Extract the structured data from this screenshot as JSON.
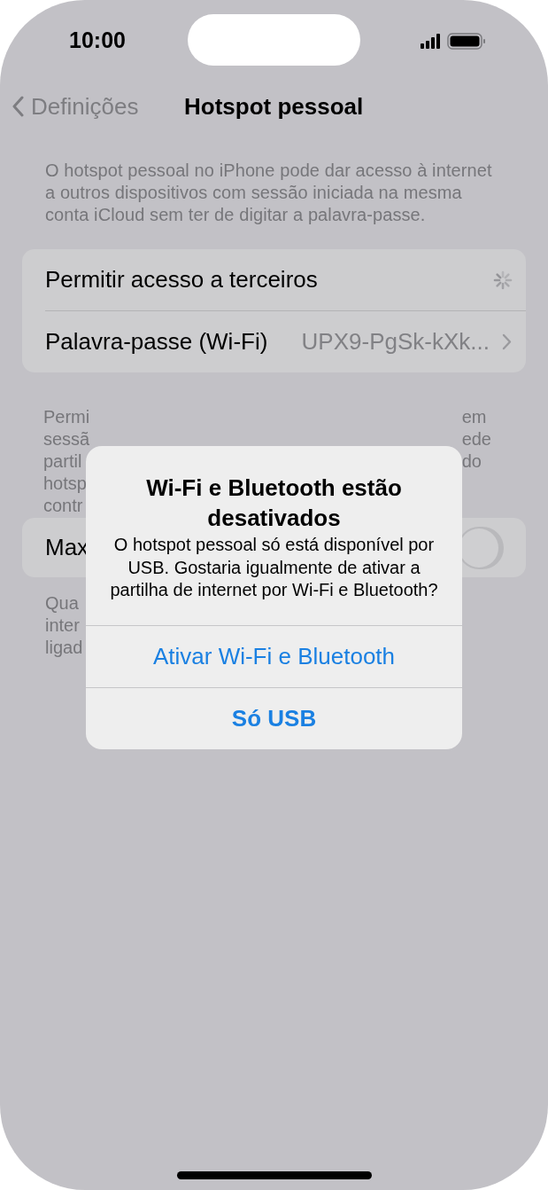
{
  "status_bar": {
    "time": "10:00"
  },
  "nav": {
    "back": "Definições",
    "title": "Hotspot pessoal"
  },
  "intro": "O hotspot pessoal no iPhone pode dar acesso à internet a outros dispositivos com sessão iniciada na mesma conta iCloud sem ter de digitar a palavra-passe.",
  "settings": [
    {
      "kind": "loading",
      "label": "Permitir acesso a terceiros"
    },
    {
      "kind": "link",
      "label": "Palavra-passe (Wi-Fi)",
      "value": "UPX9-PgSk-kXk..."
    }
  ],
  "note_1": {
    "left": [
      "Permi",
      "sessã",
      "partil",
      "hotsp",
      "contr"
    ],
    "right": [
      "em",
      "ede",
      "do"
    ]
  },
  "maximize_row": {
    "label": "Max",
    "on": false
  },
  "note_2": {
    "left": [
      "Qua",
      "inter",
      "ligad"
    ]
  },
  "alert": {
    "title": "Wi-Fi e Bluetooth estão desativados",
    "message": "O hotspot pessoal só está disponível por USB. Gostaria igualmente de ativar a partilha de internet por Wi-Fi e Bluetooth?",
    "buttons": [
      {
        "label": "Ativar Wi-Fi e Bluetooth",
        "bold": false
      },
      {
        "label": "Só USB",
        "bold": true
      }
    ]
  }
}
